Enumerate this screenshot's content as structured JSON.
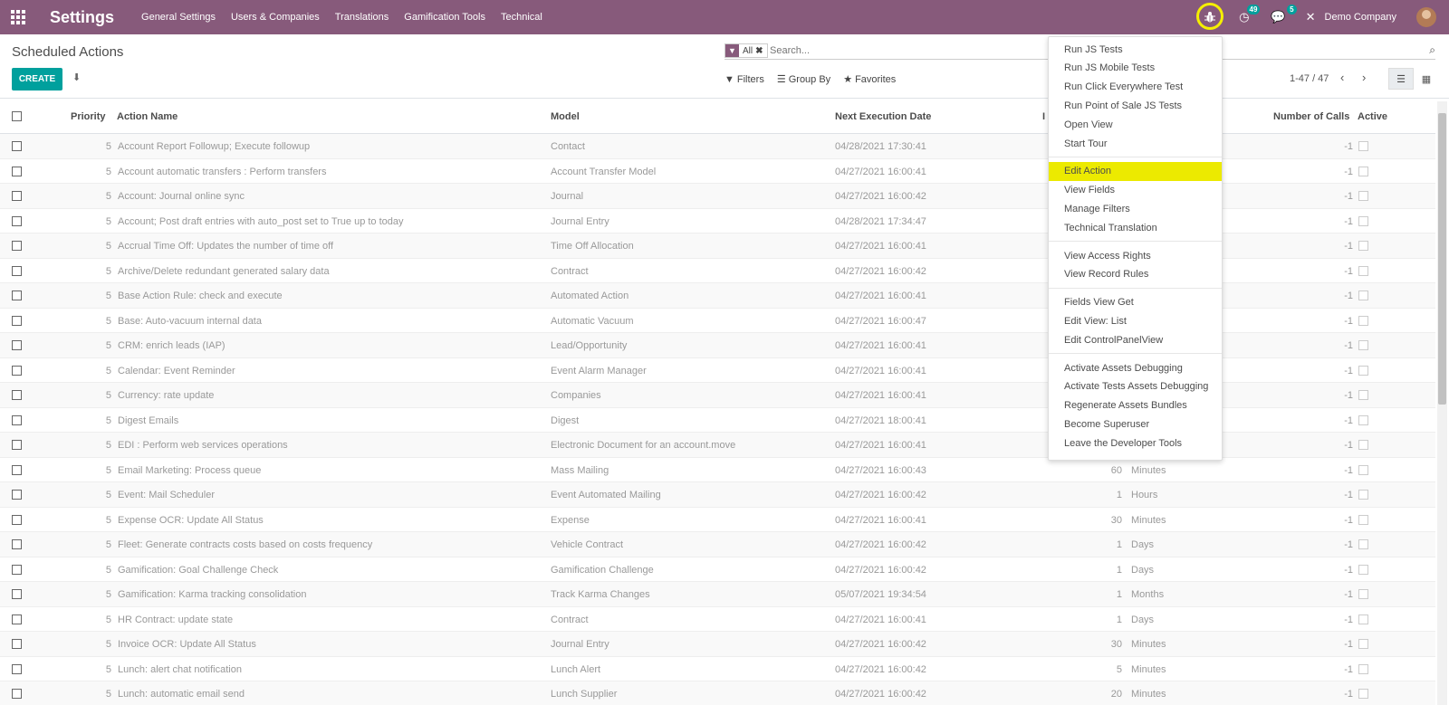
{
  "navbar": {
    "brand": "Settings",
    "menu": [
      "General Settings",
      "Users & Companies",
      "Translations",
      "Gamification Tools",
      "Technical"
    ],
    "activity_count": "49",
    "messages_count": "5",
    "company": "Demo Company",
    "accent": "#875a7b"
  },
  "control": {
    "title": "Scheduled Actions",
    "create": "CREATE",
    "facet": "All",
    "search_placeholder": "Search...",
    "filters": "Filters",
    "group_by": "Group By",
    "favorites": "Favorites",
    "pager": "1-47 / 47"
  },
  "table": {
    "headers": {
      "priority": "Priority",
      "name": "Action Name",
      "model": "Model",
      "next": "Next Execution Date",
      "interval": "I",
      "calls": "Number of Calls",
      "active": "Active"
    },
    "rows": [
      {
        "p": "5",
        "name": "Account Report Followup; Execute followup",
        "model": "Contact",
        "next": "04/28/2021 17:30:41",
        "num": "",
        "unit": "",
        "calls": "-1"
      },
      {
        "p": "5",
        "name": "Account automatic transfers : Perform transfers",
        "model": "Account Transfer Model",
        "next": "04/27/2021 16:00:41",
        "num": "",
        "unit": "",
        "calls": "-1"
      },
      {
        "p": "5",
        "name": "Account: Journal online sync",
        "model": "Journal",
        "next": "04/27/2021 16:00:42",
        "num": "",
        "unit": "",
        "calls": "-1"
      },
      {
        "p": "5",
        "name": "Account; Post draft entries with auto_post set to True up to today",
        "model": "Journal Entry",
        "next": "04/28/2021 17:34:47",
        "num": "",
        "unit": "",
        "calls": "-1"
      },
      {
        "p": "5",
        "name": "Accrual Time Off: Updates the number of time off",
        "model": "Time Off Allocation",
        "next": "04/27/2021 16:00:41",
        "num": "",
        "unit": "",
        "calls": "-1"
      },
      {
        "p": "5",
        "name": "Archive/Delete redundant generated salary data",
        "model": "Contract",
        "next": "04/27/2021 16:00:42",
        "num": "",
        "unit": "",
        "calls": "-1"
      },
      {
        "p": "5",
        "name": "Base Action Rule: check and execute",
        "model": "Automated Action",
        "next": "04/27/2021 16:00:41",
        "num": "",
        "unit": "",
        "calls": "-1"
      },
      {
        "p": "5",
        "name": "Base: Auto-vacuum internal data",
        "model": "Automatic Vacuum",
        "next": "04/27/2021 16:00:47",
        "num": "",
        "unit": "",
        "calls": "-1"
      },
      {
        "p": "5",
        "name": "CRM: enrich leads (IAP)",
        "model": "Lead/Opportunity",
        "next": "04/27/2021 16:00:41",
        "num": "",
        "unit": "",
        "calls": "-1"
      },
      {
        "p": "5",
        "name": "Calendar: Event Reminder",
        "model": "Event Alarm Manager",
        "next": "04/27/2021 16:00:41",
        "num": "",
        "unit": "",
        "calls": "-1"
      },
      {
        "p": "5",
        "name": "Currency: rate update",
        "model": "Companies",
        "next": "04/27/2021 16:00:41",
        "num": "",
        "unit": "",
        "calls": "-1"
      },
      {
        "p": "5",
        "name": "Digest Emails",
        "model": "Digest",
        "next": "04/27/2021 18:00:41",
        "num": "",
        "unit": "",
        "calls": "-1"
      },
      {
        "p": "5",
        "name": "EDI : Perform web services operations",
        "model": "Electronic Document for an account.move",
        "next": "04/27/2021 16:00:41",
        "num": "",
        "unit": "",
        "calls": "-1"
      },
      {
        "p": "5",
        "name": "Email Marketing: Process queue",
        "model": "Mass Mailing",
        "next": "04/27/2021 16:00:43",
        "num": "60",
        "unit": "Minutes",
        "calls": "-1"
      },
      {
        "p": "5",
        "name": "Event: Mail Scheduler",
        "model": "Event Automated Mailing",
        "next": "04/27/2021 16:00:42",
        "num": "1",
        "unit": "Hours",
        "calls": "-1"
      },
      {
        "p": "5",
        "name": "Expense OCR: Update All Status",
        "model": "Expense",
        "next": "04/27/2021 16:00:41",
        "num": "30",
        "unit": "Minutes",
        "calls": "-1"
      },
      {
        "p": "5",
        "name": "Fleet: Generate contracts costs based on costs frequency",
        "model": "Vehicle Contract",
        "next": "04/27/2021 16:00:42",
        "num": "1",
        "unit": "Days",
        "calls": "-1"
      },
      {
        "p": "5",
        "name": "Gamification: Goal Challenge Check",
        "model": "Gamification Challenge",
        "next": "04/27/2021 16:00:42",
        "num": "1",
        "unit": "Days",
        "calls": "-1"
      },
      {
        "p": "5",
        "name": "Gamification: Karma tracking consolidation",
        "model": "Track Karma Changes",
        "next": "05/07/2021 19:34:54",
        "num": "1",
        "unit": "Months",
        "calls": "-1"
      },
      {
        "p": "5",
        "name": "HR Contract: update state",
        "model": "Contract",
        "next": "04/27/2021 16:00:41",
        "num": "1",
        "unit": "Days",
        "calls": "-1"
      },
      {
        "p": "5",
        "name": "Invoice OCR: Update All Status",
        "model": "Journal Entry",
        "next": "04/27/2021 16:00:42",
        "num": "30",
        "unit": "Minutes",
        "calls": "-1"
      },
      {
        "p": "5",
        "name": "Lunch: alert chat notification",
        "model": "Lunch Alert",
        "next": "04/27/2021 16:00:42",
        "num": "5",
        "unit": "Minutes",
        "calls": "-1"
      },
      {
        "p": "5",
        "name": "Lunch: automatic email send",
        "model": "Lunch Supplier",
        "next": "04/27/2021 16:00:42",
        "num": "20",
        "unit": "Minutes",
        "calls": "-1"
      }
    ]
  },
  "debug_menu": {
    "groups": [
      [
        "Run JS Tests",
        "Run JS Mobile Tests",
        "Run Click Everywhere Test",
        "Run Point of Sale JS Tests",
        "Open View",
        "Start Tour"
      ],
      [
        "Edit Action",
        "View Fields",
        "Manage Filters",
        "Technical Translation"
      ],
      [
        "View Access Rights",
        "View Record Rules"
      ],
      [
        "Fields View Get",
        "Edit View: List",
        "Edit ControlPanelView"
      ],
      [
        "Activate Assets Debugging",
        "Activate Tests Assets Debugging",
        "Regenerate Assets Bundles",
        "Become Superuser",
        "Leave the Developer Tools"
      ]
    ],
    "highlighted": "Edit Action",
    "highlight_color": "#ecea00"
  }
}
